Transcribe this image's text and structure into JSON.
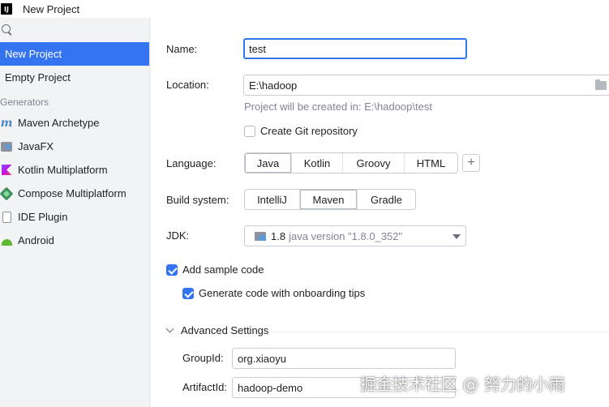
{
  "window": {
    "title": "New Project",
    "app_icon_text": "IJ"
  },
  "sidebar": {
    "items": [
      {
        "label": "New Project",
        "selected": true
      },
      {
        "label": "Empty Project",
        "selected": false
      }
    ],
    "section_label": "Generators",
    "generators": [
      {
        "label": "Maven Archetype",
        "icon": "maven-icon"
      },
      {
        "label": "JavaFX",
        "icon": "javafx-icon"
      },
      {
        "label": "Kotlin Multiplatform",
        "icon": "kotlin-icon"
      },
      {
        "label": "Compose Multiplatform",
        "icon": "compose-icon"
      },
      {
        "label": "IDE Plugin",
        "icon": "plugin-icon"
      },
      {
        "label": "Android",
        "icon": "android-icon"
      }
    ]
  },
  "form": {
    "name_label": "Name:",
    "name_value": "test",
    "location_label": "Location:",
    "location_value": "E:\\hadoop",
    "location_hint": "Project will be created in: E:\\hadoop\\test",
    "git_label": "Create Git repository",
    "git_checked": false,
    "language_label": "Language:",
    "languages": [
      "Java",
      "Kotlin",
      "Groovy",
      "HTML"
    ],
    "language_selected": "Java",
    "add_language": "+",
    "build_label": "Build system:",
    "build_systems": [
      "IntelliJ",
      "Maven",
      "Gradle"
    ],
    "build_selected": "Maven",
    "jdk_label": "JDK:",
    "jdk_version": "1.8",
    "jdk_desc": "java version \"1.8.0_352\"",
    "sample_code_label": "Add sample code",
    "sample_code_checked": true,
    "onboarding_label": "Generate code with onboarding tips",
    "onboarding_checked": true,
    "advanced_label": "Advanced Settings",
    "groupid_label": "GroupId:",
    "groupid_value": "org.xiaoyu",
    "artifactid_label": "ArtifactId:",
    "artifactid_value": "hadoop-demo"
  },
  "watermark": "掘金技术社区 @ 努力的小雨",
  "colors": {
    "accent": "#3574f0",
    "sidebar_bg": "#f2f3f5",
    "hint": "#818594"
  }
}
